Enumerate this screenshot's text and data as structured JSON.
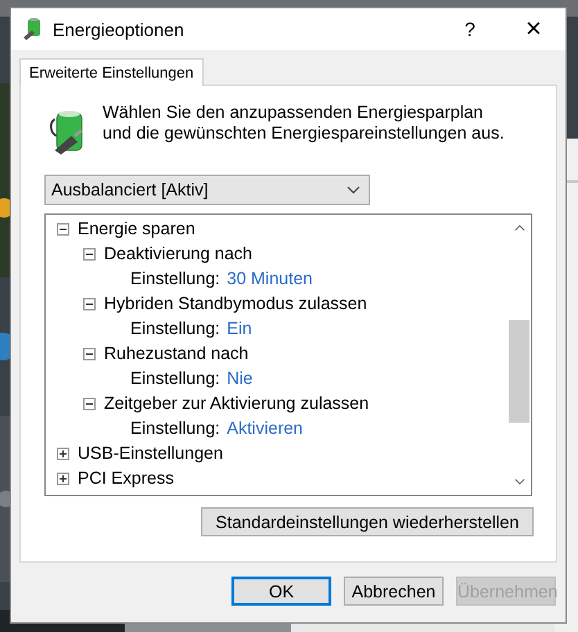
{
  "window": {
    "title": "Energieoptionen",
    "help": "?",
    "close": "×"
  },
  "tabs": [
    {
      "label": "Erweiterte Einstellungen",
      "selected": true
    }
  ],
  "intro": "Wählen Sie den anzupassenden Energiesparplan und die gewünschten Energiespareinstellungen aus.",
  "plan_dropdown": {
    "value": "Ausbalanciert [Aktiv]"
  },
  "tree": [
    {
      "kind": "group",
      "label": "Energie sparen",
      "expanded": true,
      "children": [
        {
          "kind": "group",
          "label": "Deaktivierung nach",
          "expanded": true,
          "children": [
            {
              "kind": "setting",
              "label": "Einstellung:",
              "value": "30 Minuten"
            }
          ]
        },
        {
          "kind": "group",
          "label": "Hybriden Standbymodus zulassen",
          "expanded": true,
          "children": [
            {
              "kind": "setting",
              "label": "Einstellung:",
              "value": "Ein"
            }
          ]
        },
        {
          "kind": "group",
          "label": "Ruhezustand nach",
          "expanded": true,
          "children": [
            {
              "kind": "setting",
              "label": "Einstellung:",
              "value": "Nie"
            }
          ]
        },
        {
          "kind": "group",
          "label": "Zeitgeber zur Aktivierung zulassen",
          "expanded": true,
          "children": [
            {
              "kind": "setting",
              "label": "Einstellung:",
              "value": "Aktivieren"
            }
          ]
        }
      ]
    },
    {
      "kind": "group",
      "label": "USB-Einstellungen",
      "expanded": false
    },
    {
      "kind": "group",
      "label": "PCI Express",
      "expanded": false
    }
  ],
  "restore_button": "Standardeinstellungen wiederherstellen",
  "buttons": [
    {
      "label": "OK",
      "default": true,
      "disabled": false
    },
    {
      "label": "Abbrechen",
      "default": false,
      "disabled": false
    },
    {
      "label": "Übernehmen",
      "default": false,
      "disabled": true
    }
  ]
}
